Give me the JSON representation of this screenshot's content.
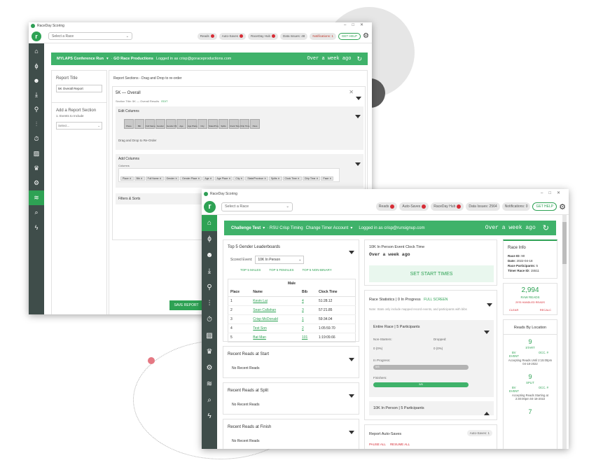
{
  "back": {
    "title": "RaceDay Scoring",
    "select_race": "Select a Race",
    "pills": [
      {
        "label": "Reads",
        "dot": true
      },
      {
        "label": "Auto-Saves",
        "dot": true
      },
      {
        "label": "RaceDay Hub",
        "dot": true
      },
      {
        "label": "Data Issues: 48",
        "dot": false
      },
      {
        "label": "Notifications: 1",
        "dot": false,
        "red": true
      }
    ],
    "help": "GET HELP",
    "green_bar": {
      "event": "MYLAPS Conference Run",
      "account": "GO Race Productions",
      "user": "Logged in as crisp@goraceproductions.com",
      "time": "Over a week ago"
    },
    "report_title_label": "Report Title",
    "report_title_value": "5K Overall Report",
    "add_section_label": "Add a Report Section",
    "add_section_hint": "1. Events to Include",
    "add_section_select": "Select...",
    "sections_header": "Report Sections - Drag and Drop to re-order",
    "section": {
      "title": "5K — Overall",
      "subtitle": "Section Title: 5K — Overall Results",
      "edit": "EDIT"
    },
    "edit_columns_label": "Edit Columns",
    "edit_columns": [
      "Place",
      "Bib",
      "Full Name",
      "Gender",
      "Gender Place",
      "Age",
      "Age Place",
      "City",
      "State/Province",
      "Splits",
      "Clock Time",
      "Chip Time",
      "Pace"
    ],
    "drag_hint": "Drag and Drop to Re-Order",
    "add_columns_label": "Add Columns",
    "columns_label": "Columns",
    "column_chips": [
      "Place",
      "Bib",
      "Full Name",
      "Gender",
      "Gender Place",
      "Age",
      "Age Place",
      "City",
      "State/Province",
      "Splits",
      "Clock Time",
      "Chip Time",
      "Pace"
    ],
    "filters_label": "Filters & Sorts",
    "save_button": "SAVE REPORT"
  },
  "front": {
    "title": "RaceDay Scoring",
    "select_race": "Select a Race",
    "pills": [
      {
        "label": "Reads",
        "dot": true
      },
      {
        "label": "Auto-Saves",
        "dot": true
      },
      {
        "label": "RaceDay Hub",
        "dot": true
      },
      {
        "label": "Data Issues: 2564",
        "dot": false
      },
      {
        "label": "Notifications: 0",
        "dot": false
      }
    ],
    "help": "GET HELP",
    "green_bar": {
      "event": "Challenge Test",
      "account": "RSU Crisp Timing",
      "change": "Change Timer Account",
      "user": "Logged in as crisp@runsignup.com",
      "time": "Over a week ago"
    },
    "leaderboard": {
      "title": "Top 5 Gender Leaderboards",
      "scored_label": "Scored Event:",
      "scored_value": "10K In Person",
      "links": [
        "TOP 5 MALES",
        "TOP 5 FEMALES",
        "TOP 5 NON-BINARY"
      ],
      "group": "Male",
      "headers": [
        "Place",
        "Name",
        "Bib",
        "Clock Time"
      ],
      "rows": [
        [
          "1",
          "Kevin Lai",
          "4",
          "51:28.12"
        ],
        [
          "2",
          "Sean Callahan",
          "3",
          "57:21.85"
        ],
        [
          "3",
          "Crisp McDonald",
          "1",
          "59:34.04"
        ],
        [
          "4",
          "Test Son",
          "2",
          "1:05:59.70"
        ],
        [
          "5",
          "Bat Man",
          "101",
          "1:19:09.66"
        ]
      ]
    },
    "recent_start": {
      "title": "Recent Reads at Start",
      "empty": "No Recent Reads"
    },
    "recent_split": {
      "title": "Recent Reads at Split",
      "empty": "No Recent Reads"
    },
    "recent_finish": {
      "title": "Recent Reads at Finish",
      "empty": "No Recent Reads"
    },
    "clock": {
      "title": "10K In Person Event Clock Time",
      "value": "Over a week ago",
      "button": "SET START TIMES"
    },
    "stats": {
      "title": "Race Statistics | 0 In Progress",
      "full_screen": "FULL SCREEN",
      "note": "Note: Stats only include mapped record events, and participants with bibs",
      "entire": "Entire Race | 5 Participants",
      "non_starters_label": "Non-Starters:",
      "non_starters": "0 (0%)",
      "dropped_label": "Dropped:",
      "dropped": "0 (0%)",
      "in_progress_label": "In Progress:",
      "in_progress_bar": "0/5",
      "in_progress": 0,
      "finishers_label": "Finishers:",
      "finishers_bar": "5/5",
      "finishers": 1.0,
      "event_row": "10K In Person | 5 Participants"
    },
    "autosaves": {
      "title": "Report Auto-Saves",
      "badge": "Auto-Saves: 1",
      "pause": "PAUSE ALL",
      "resume": "RESUME ALL"
    },
    "race_info": {
      "title": "Race Info",
      "id_label": "Race ID:",
      "id": "90",
      "date_label": "Date:",
      "date": "2022-04-18",
      "participants_label": "Race Participants:",
      "participants": "5",
      "timer_label": "Timer Race ID:",
      "timer": "15511"
    },
    "raw": {
      "count": "2,994",
      "label": "RAW READS",
      "handled": "2976 HANDLED READS",
      "clear": "CLEAR",
      "recalc": "RECALC"
    },
    "by_location": {
      "title": "Reads By Location",
      "locations": [
        {
          "count": "9",
          "name": "START",
          "bv": "BV",
          "occ": "OCC. #",
          "event": "EVENT",
          "status": "Accepting Reads Until 2:15:00pm 04-18-2022"
        },
        {
          "count": "9",
          "name": "SPLIT",
          "bv": "BV",
          "occ": "OCC. #",
          "event": "EVENT",
          "status": "Accepting Reads Starting at 2:30:00pm 04-18-2022"
        },
        {
          "count": "7",
          "name": "",
          "bv": "",
          "occ": "",
          "event": "",
          "status": ""
        }
      ]
    }
  }
}
